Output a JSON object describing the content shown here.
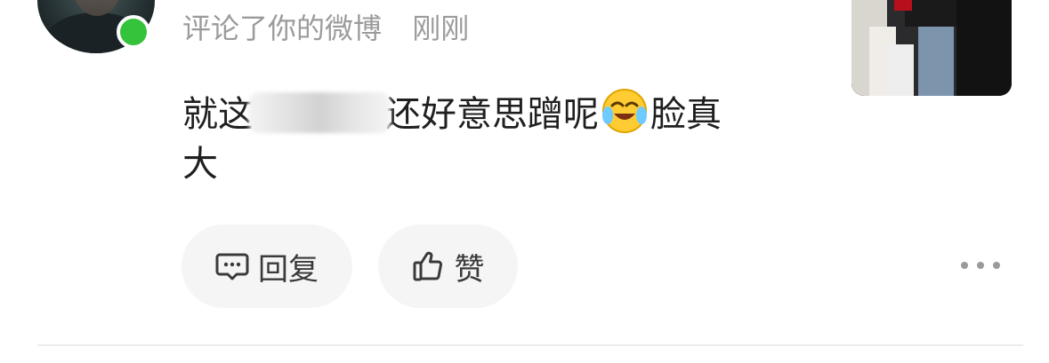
{
  "comment": {
    "action_text": "评论了你的微博",
    "time": "刚刚",
    "text_before": "就这",
    "text_after_redaction": "还好意思蹭呢",
    "text_end_line1": "脸真",
    "text_line2": "大",
    "emoji": "laughing-crying-emoji"
  },
  "actions": {
    "reply_label": "回复",
    "like_label": "赞"
  },
  "status": {
    "online_color": "#35c33b"
  },
  "icons": {
    "reply": "comment-bubble-icon",
    "like": "thumbs-up-icon",
    "more": "more-dots-icon"
  }
}
